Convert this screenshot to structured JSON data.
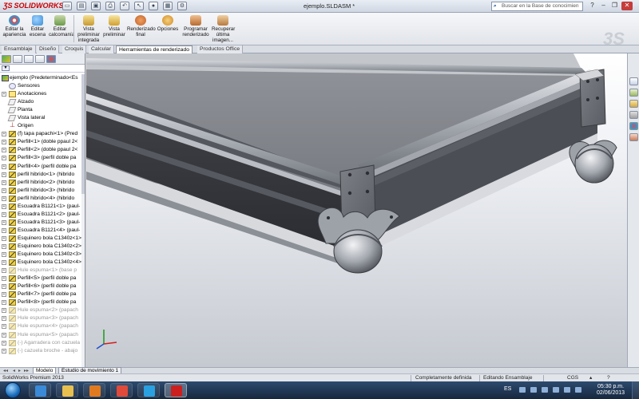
{
  "app": {
    "logo_text": "SOLIDWORKS",
    "document_title": "ejemplo.SLDASM *",
    "search_placeholder": "Buscar en la Base de conocimien",
    "brand_color": "#cc0000"
  },
  "ribbon": {
    "buttons": [
      {
        "label": "Editar la apariencia",
        "icon": "appearance-icon",
        "color": "#e84a3c"
      },
      {
        "label": "Editar escena",
        "icon": "scene-icon",
        "color": "#3a8fd8"
      },
      {
        "label": "Editar calcomanía",
        "icon": "decal-icon",
        "color": "#6a9a4a"
      },
      {
        "label": "Vista preliminar integrada",
        "icon": "preview-integrated-icon",
        "color": "#c89a30"
      },
      {
        "label": "Vista preliminar",
        "icon": "preview-icon",
        "color": "#d0a030"
      },
      {
        "label": "Renderizado final",
        "icon": "final-render-icon",
        "color": "#c0602a"
      },
      {
        "label": "Opciones",
        "icon": "options-icon",
        "color": "#d08a20"
      },
      {
        "label": "Programar renderizado",
        "icon": "schedule-render-icon",
        "color": "#b86a30"
      },
      {
        "label": "Recuperar última imagen...",
        "icon": "recall-image-icon",
        "color": "#b87a40"
      }
    ]
  },
  "tabs": [
    {
      "label": "Ensamblaje",
      "active": false
    },
    {
      "label": "Diseño",
      "active": false
    },
    {
      "label": "Croquis",
      "active": false
    },
    {
      "label": "Calcular",
      "active": false
    },
    {
      "label": "Herramientas de renderizado",
      "active": true
    },
    {
      "label": "Productos Office",
      "active": false
    }
  ],
  "tree": {
    "root_label": "ejemplo  (Predeterminado<Es",
    "items": [
      {
        "label": "Sensores",
        "icon": "sensor",
        "expand": false,
        "gray": false
      },
      {
        "label": "Anotaciones",
        "icon": "annotation",
        "expand": true,
        "gray": false
      },
      {
        "label": "Alzado",
        "icon": "plane",
        "expand": false,
        "gray": false
      },
      {
        "label": "Planta",
        "icon": "plane",
        "expand": false,
        "gray": false
      },
      {
        "label": "Vista lateral",
        "icon": "plane",
        "expand": false,
        "gray": false
      },
      {
        "label": "Origen",
        "icon": "origin",
        "expand": false,
        "gray": false
      },
      {
        "label": "(f) tapa papachi<1> (Pred",
        "icon": "part",
        "expand": true,
        "gray": false
      },
      {
        "label": "Perfill<1> (doble ppaul 2<",
        "icon": "part",
        "expand": true,
        "gray": false
      },
      {
        "label": "Perfill<2> (doble ppaul 2<",
        "icon": "part",
        "expand": true,
        "gray": false
      },
      {
        "label": "Perfill<3> (perfil doble pa",
        "icon": "part",
        "expand": true,
        "gray": false
      },
      {
        "label": "Perfill<4> (perfil doble pa",
        "icon": "part",
        "expand": true,
        "gray": false
      },
      {
        "label": "perfil hibrido<1> (hibrido",
        "icon": "part",
        "expand": true,
        "gray": false
      },
      {
        "label": "perfil hibrido<2> (hibrido",
        "icon": "part",
        "expand": true,
        "gray": false
      },
      {
        "label": "perfil hibrido<3> (hibrido",
        "icon": "part",
        "expand": true,
        "gray": false
      },
      {
        "label": "perfil hibrido<4> (hibrido",
        "icon": "part",
        "expand": true,
        "gray": false
      },
      {
        "label": "Escuadra B1121<1> (paul-",
        "icon": "part",
        "expand": true,
        "gray": false
      },
      {
        "label": "Escuadra B1121<2> (paul-",
        "icon": "part",
        "expand": true,
        "gray": false
      },
      {
        "label": "Escuadra B1121<3> (paul-",
        "icon": "part",
        "expand": true,
        "gray": false
      },
      {
        "label": "Escuadra B1121<4> (paul-",
        "icon": "part",
        "expand": true,
        "gray": false
      },
      {
        "label": "Esquinero bola C1340z<1>",
        "icon": "part",
        "expand": true,
        "gray": false
      },
      {
        "label": "Esquinero bola C1340z<2>",
        "icon": "part",
        "expand": true,
        "gray": false
      },
      {
        "label": "Esquinero bola C1340z<3>",
        "icon": "part",
        "expand": true,
        "gray": false
      },
      {
        "label": "Esquinero bola C1340z<4>",
        "icon": "part",
        "expand": true,
        "gray": false
      },
      {
        "label": "Hule espuma<1> (base p",
        "icon": "part",
        "expand": true,
        "gray": true
      },
      {
        "label": "Perfill<5> (perfil doble pa",
        "icon": "part",
        "expand": true,
        "gray": false
      },
      {
        "label": "Perfill<6> (perfil doble pa",
        "icon": "part",
        "expand": true,
        "gray": false
      },
      {
        "label": "Perfill<7> (perfil doble pa",
        "icon": "part",
        "expand": true,
        "gray": false
      },
      {
        "label": "Perfill<8> (perfil doble pa",
        "icon": "part",
        "expand": true,
        "gray": false
      },
      {
        "label": "Hule espuma<2> (papach",
        "icon": "part",
        "expand": true,
        "gray": true
      },
      {
        "label": "Hule espuma<3> (papach",
        "icon": "part",
        "expand": true,
        "gray": true
      },
      {
        "label": "Hule espuma<4> (papach",
        "icon": "part",
        "expand": true,
        "gray": true
      },
      {
        "label": "Hule espuma<5> (papach",
        "icon": "part",
        "expand": true,
        "gray": true
      },
      {
        "label": "(-) Agarradera con cazuela",
        "icon": "part",
        "expand": true,
        "gray": true
      },
      {
        "label": "(-) cazuela broche - abajo",
        "icon": "part",
        "expand": true,
        "gray": true
      }
    ]
  },
  "bottom_tabs": [
    {
      "label": "Modelo",
      "active": true
    },
    {
      "label": "Estudio de movimiento 1",
      "active": false
    }
  ],
  "status": {
    "product": "SolidWorks Premium 2013",
    "definition": "Completamente definida",
    "mode": "Editando Ensamblaje",
    "units": "CGS"
  },
  "taskbar": {
    "language": "ES",
    "time": "05:30 p.m.",
    "date": "02/06/2013",
    "apps": [
      {
        "name": "ie-icon",
        "color": "#3a8ad8",
        "active": false
      },
      {
        "name": "explorer-icon",
        "color": "#e8c050",
        "active": false
      },
      {
        "name": "media-player-icon",
        "color": "#e07a20",
        "active": false
      },
      {
        "name": "chrome-icon",
        "color": "#e04a3a",
        "active": false
      },
      {
        "name": "skype-icon",
        "color": "#2aa0e0",
        "active": false
      },
      {
        "name": "solidworks-icon",
        "color": "#cc2020",
        "active": true
      }
    ]
  }
}
